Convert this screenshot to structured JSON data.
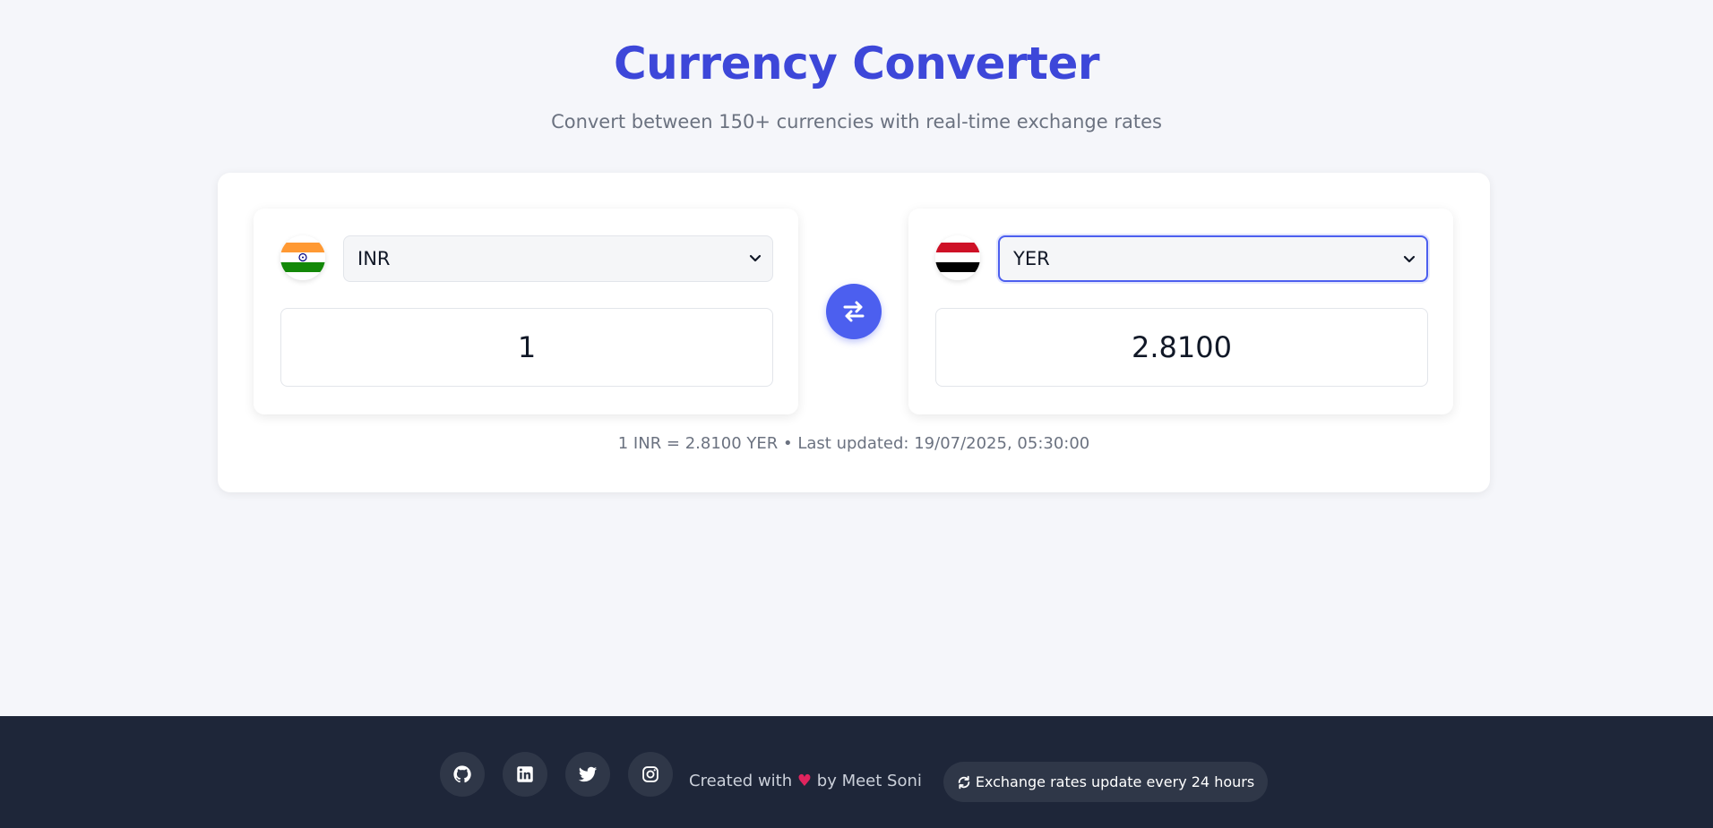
{
  "header": {
    "title": "Currency Converter",
    "subtitle": "Convert between 150+ currencies with real-time exchange rates"
  },
  "converter": {
    "from": {
      "currency": "INR",
      "amount": "1",
      "flag_icon": "india-flag-icon"
    },
    "to": {
      "currency": "YER",
      "amount": "2.8100",
      "flag_icon": "yemen-flag-icon"
    },
    "rate_info": "1 INR = 2.8100 YER • Last updated: 19/07/2025, 05:30:00",
    "swap_icon": "swap-arrows-icon"
  },
  "footer": {
    "social": [
      "github-icon",
      "linkedin-icon",
      "twitter-icon",
      "instagram-icon"
    ],
    "credit_prefix": "Created with",
    "credit_suffix": "by Meet Soni",
    "update_notice": "Exchange rates update every 24 hours"
  },
  "colors": {
    "accent": "#4c5fef",
    "title": "#3d47d9",
    "footer_bg": "#1e2639",
    "page_bg": "#f5f6fa"
  }
}
